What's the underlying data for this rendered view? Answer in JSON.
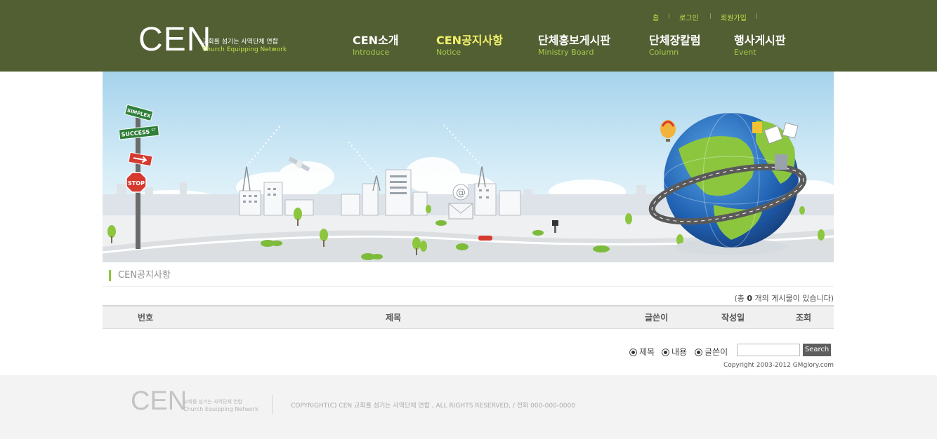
{
  "header": {
    "logo_text": "CEN",
    "logo_sub_kr": "교회를 섬기는 사역단체 연합",
    "logo_sub_en": "Church Equipping Network",
    "util_links": [
      "홈",
      "로그인",
      "회원가입"
    ],
    "nav": [
      {
        "kr": "CEN소개",
        "en": "Introduce"
      },
      {
        "kr": "CEN공지사항",
        "en": "Notice"
      },
      {
        "kr": "단체홍보게시판",
        "en": "Ministry Board"
      },
      {
        "kr": "단체장칼럼",
        "en": "Column"
      },
      {
        "kr": "행사게시판",
        "en": "Event"
      }
    ]
  },
  "banner": {
    "signs": [
      "SIMPLEX",
      "SUCCESS",
      "STOP"
    ],
    "sign_suffix": "ST",
    "email_symbol": "@"
  },
  "board": {
    "title": "CEN공지사항",
    "count_prefix": "(총",
    "count_value": "0",
    "count_suffix": "개의 게시물이 있습니다)",
    "columns": [
      "번호",
      "제목",
      "글쓴이",
      "작성일",
      "조회"
    ],
    "search_options": [
      "제목",
      "내용",
      "글쓴이"
    ],
    "search_value": "",
    "search_button": "Search",
    "copyright_small": "Copyright 2003-2012 GMglory.com"
  },
  "footer": {
    "logo_text": "CEN",
    "logo_sub_kr": "교회를 섬기는 사역단체 연합",
    "logo_sub_en": "Church Equipping Network",
    "copyright": "COPYRIGHT(C) CEN 교회를 섬기는 사역단체 연합 , ALL RIGHTS RESERVED,  / 전화 000-000-0000"
  },
  "colors": {
    "header_bg": "#525f33",
    "accent_green": "#8cc63f",
    "active_nav": "#f4f06a"
  }
}
